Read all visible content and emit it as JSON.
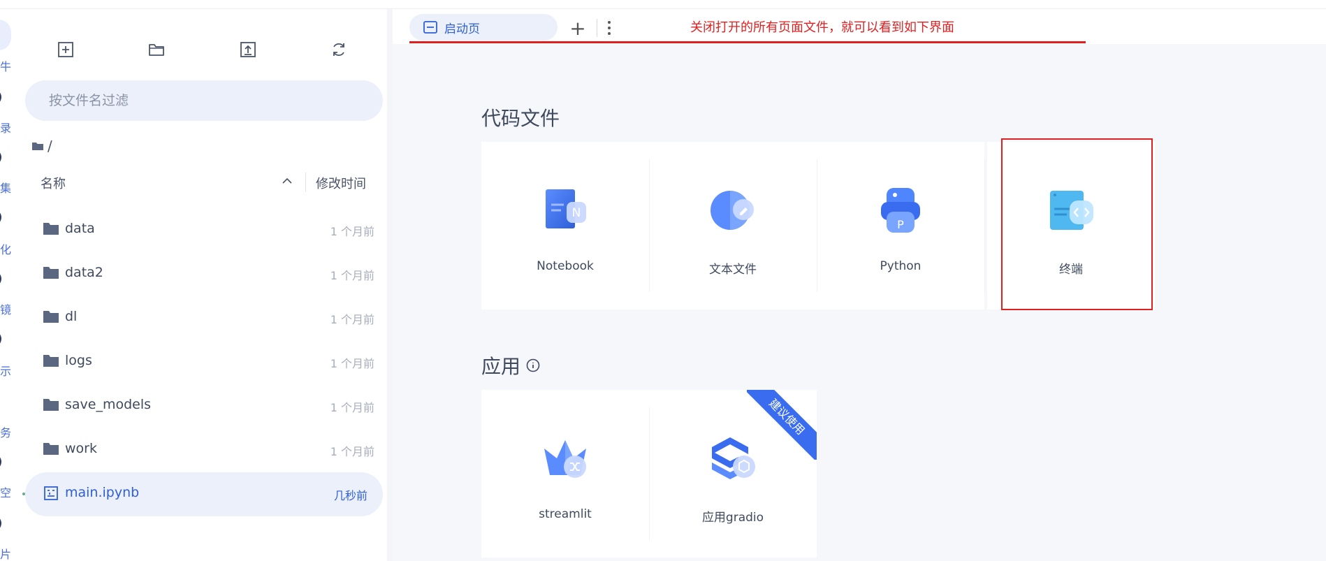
{
  "panel": {
    "toolbar": {
      "new_launcher": "new-launcher-icon",
      "new_folder": "new-folder-icon",
      "upload": "upload-icon",
      "refresh": "refresh-icon"
    },
    "filter_placeholder": "按文件名过滤",
    "breadcrumb": "/",
    "columns": {
      "name": "名称",
      "modified": "修改时间"
    },
    "files": [
      {
        "name": "data",
        "time": "1 个月前",
        "type": "folder"
      },
      {
        "name": "data2",
        "time": "1 个月前",
        "type": "folder"
      },
      {
        "name": "dl",
        "time": "1 个月前",
        "type": "folder"
      },
      {
        "name": "logs",
        "time": "1 个月前",
        "type": "folder"
      },
      {
        "name": "save_models",
        "time": "1 个月前",
        "type": "folder"
      },
      {
        "name": "work",
        "time": "1 个月前",
        "type": "folder"
      },
      {
        "name": "main.ipynb",
        "time": "几秒前",
        "type": "notebook"
      }
    ]
  },
  "rail_chars": [
    "牛",
    "录",
    "集",
    "化",
    "镜",
    "示",
    "务",
    "空",
    "片"
  ],
  "tabs": [
    {
      "label": "启动页"
    }
  ],
  "annotation": "关闭打开的所有页面文件，就可以看到如下界面",
  "sections": {
    "code": {
      "title": "代码文件",
      "cards": [
        {
          "label": "Notebook"
        },
        {
          "label": "文本文件"
        },
        {
          "label": "Python"
        },
        {
          "label": "终端"
        }
      ]
    },
    "apps": {
      "title": "应用",
      "cards": [
        {
          "label": "streamlit"
        },
        {
          "label": "应用gradio"
        }
      ],
      "ribbon": "建议使用"
    }
  },
  "colors": {
    "accent": "#2f5fd8",
    "annotation": "#e02020",
    "selected_bg": "#ebf0fa"
  }
}
